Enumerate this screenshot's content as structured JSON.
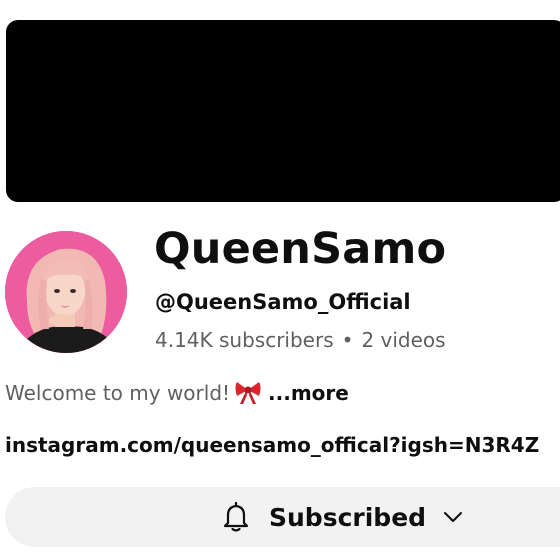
{
  "channel": {
    "name": "QueenSamo",
    "handle": "@QueenSamo_Official",
    "subscribers": "4.14K subscribers",
    "separator": "•",
    "videos": "2 videos",
    "description": "Welcome to my world!",
    "more_label": "...more",
    "link": "instagram.com/queensamo_offical?igsh=N3R4Z",
    "banner_color": "#000000",
    "avatar_bg": "#ec5c9e"
  },
  "subscribe_button": {
    "label": "Subscribed",
    "icon_left": "bell-icon",
    "icon_right": "chevron-down-icon"
  }
}
